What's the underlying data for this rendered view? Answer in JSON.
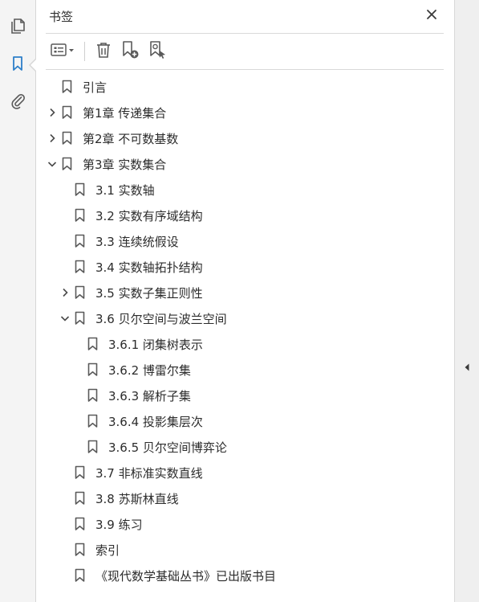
{
  "sidebar": {
    "rail": [
      {
        "name": "pages",
        "icon": "pages-icon"
      },
      {
        "name": "bookmarks",
        "icon": "bookmark-icon",
        "active": true
      },
      {
        "name": "attachments",
        "icon": "paperclip-icon"
      }
    ]
  },
  "panel": {
    "title": "书签",
    "close_icon": "close-icon",
    "toolbar": [
      {
        "name": "options",
        "icon": "list-options-icon"
      },
      {
        "name": "delete",
        "icon": "trash-icon"
      },
      {
        "name": "new-bookmark",
        "icon": "bookmark-add-icon"
      },
      {
        "name": "find-bookmark",
        "icon": "bookmark-search-icon"
      }
    ]
  },
  "bookmarks": [
    {
      "label": "引言",
      "level": 0,
      "toggle": "none"
    },
    {
      "label": "第1章 传递集合",
      "level": 0,
      "toggle": "collapsed"
    },
    {
      "label": "第2章 不可数基数",
      "level": 0,
      "toggle": "collapsed"
    },
    {
      "label": "第3章 实数集合",
      "level": 0,
      "toggle": "expanded"
    },
    {
      "label": "3.1 实数轴",
      "level": 1,
      "toggle": "none"
    },
    {
      "label": "3.2 实数有序域结构",
      "level": 1,
      "toggle": "none"
    },
    {
      "label": "3.3 连续统假设",
      "level": 1,
      "toggle": "none"
    },
    {
      "label": "3.4 实数轴拓扑结构",
      "level": 1,
      "toggle": "none"
    },
    {
      "label": "3.5 实数子集正则性",
      "level": 1,
      "toggle": "collapsed"
    },
    {
      "label": "3.6 贝尔空间与波兰空间",
      "level": 1,
      "toggle": "expanded"
    },
    {
      "label": "3.6.1 闭集树表示",
      "level": 2,
      "toggle": "none"
    },
    {
      "label": "3.6.2 博雷尔集",
      "level": 2,
      "toggle": "none"
    },
    {
      "label": "3.6.3 解析子集",
      "level": 2,
      "toggle": "none"
    },
    {
      "label": "3.6.4 投影集层次",
      "level": 2,
      "toggle": "none"
    },
    {
      "label": "3.6.5 贝尔空间博弈论",
      "level": 2,
      "toggle": "none"
    },
    {
      "label": "3.7 非标准实数直线",
      "level": 1,
      "toggle": "none"
    },
    {
      "label": "3.8 苏斯林直线",
      "level": 1,
      "toggle": "none"
    },
    {
      "label": "3.9 练习",
      "level": 1,
      "toggle": "none"
    },
    {
      "label": "索引",
      "level": 1,
      "toggle": "none"
    },
    {
      "label": "《现代数学基础丛书》已出版书目",
      "level": 1,
      "toggle": "none"
    }
  ],
  "splitter": {
    "icon": "collapse-left-arrow-icon"
  },
  "colors": {
    "accent": "#2d7fc9",
    "icon": "#5a5a5a",
    "text": "#2c2c2c"
  }
}
